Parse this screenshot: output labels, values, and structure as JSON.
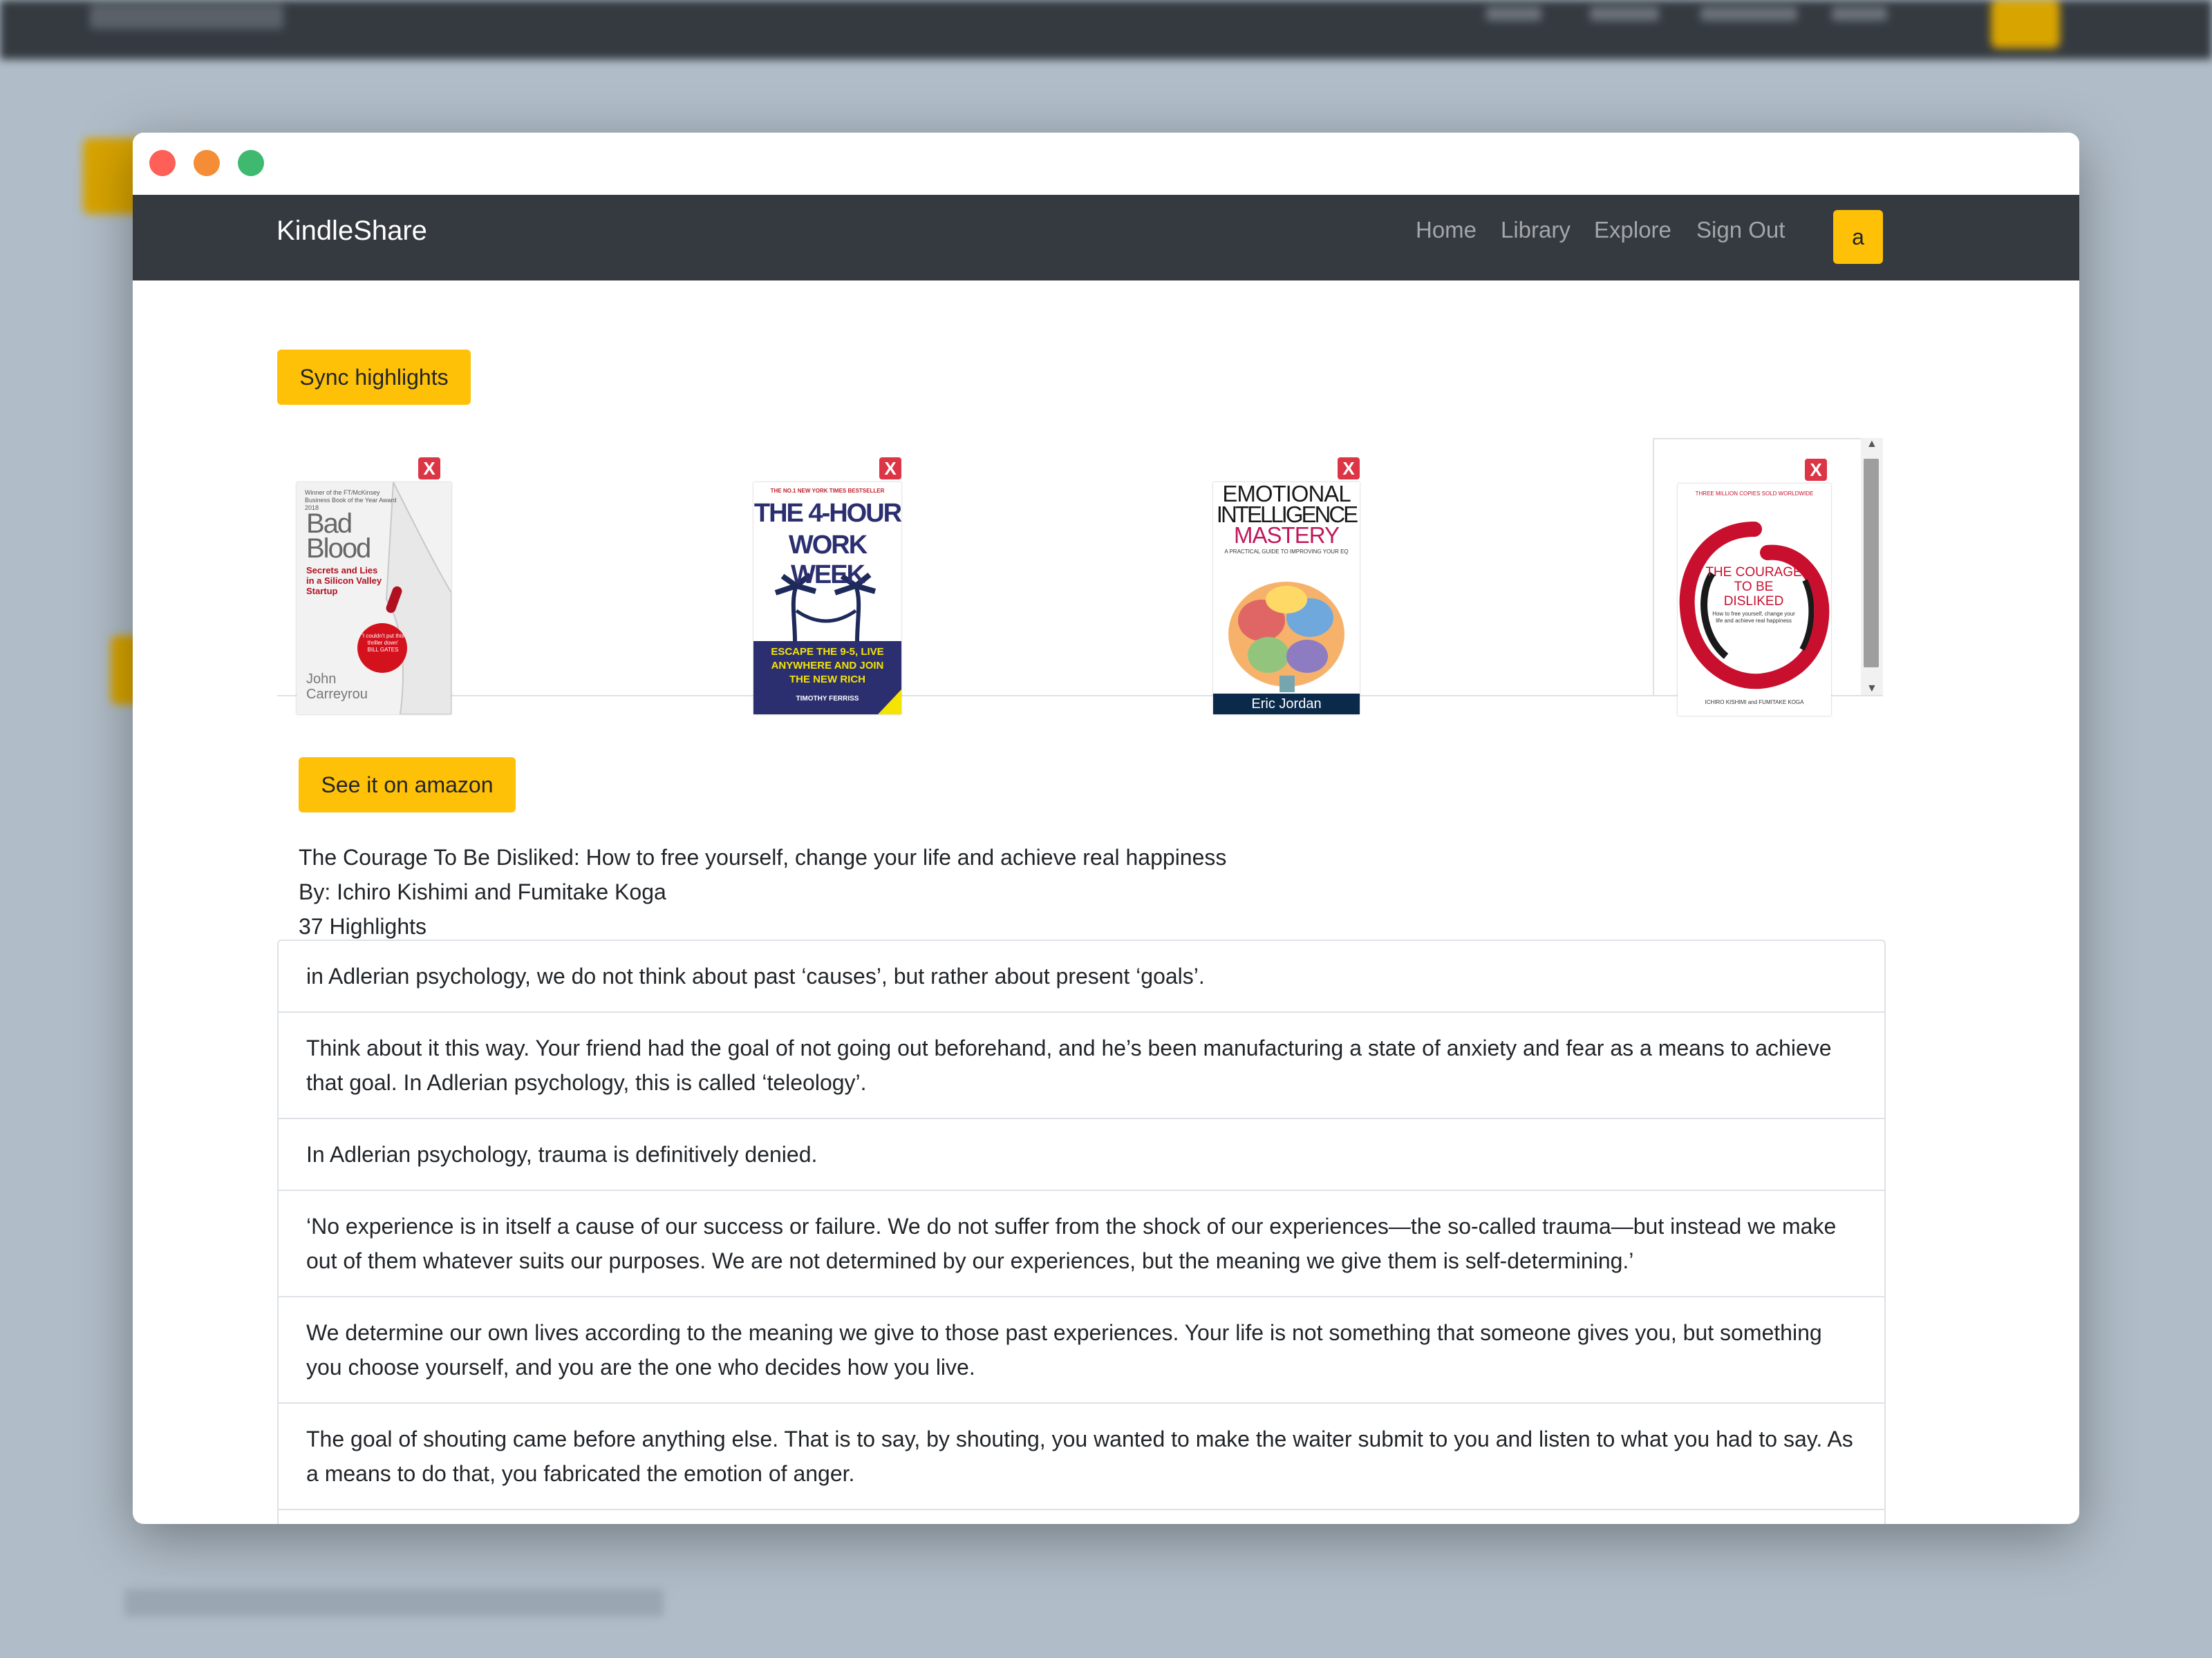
{
  "app": {
    "brand": "KindleShare",
    "nav": [
      "Home",
      "Library",
      "Explore",
      "Sign Out"
    ],
    "user_initial": "a"
  },
  "actions": {
    "sync_label": "Sync highlights",
    "amazon_label": "See it on amazon",
    "remove_label": "X"
  },
  "books": [
    {
      "cover_title": "Bad Blood",
      "cover_subtitle": "Secrets and Lies in a Silicon Valley Startup",
      "cover_author": "John Carreyrou",
      "cover_top": "Winner of the FT/McKinsey Business Book of the Year Award 2018",
      "cover_quote": "'I couldn't put this thriller down' BILL GATES"
    },
    {
      "cover_top": "THE NO.1 NEW YORK TIMES BESTSELLER",
      "cover_title_a": "THE 4-HOUR",
      "cover_title_b": "WORK WEEK",
      "cover_subtitle": "ESCAPE THE 9-5, LIVE ANYWHERE AND JOIN THE NEW RICH",
      "cover_author": "TIMOTHY FERRISS"
    },
    {
      "cover_title_a": "EMOTIONAL",
      "cover_title_b": "INTELLIGENCE",
      "cover_title_c": "MASTERY",
      "cover_subtitle": "A PRACTICAL GUIDE TO IMPROVING YOUR EQ",
      "cover_author": "Eric Jordan"
    },
    {
      "cover_top": "THREE MILLION COPIES SOLD WORLDWIDE",
      "cover_title": "THE COURAGE TO BE DISLIKED",
      "cover_subtitle": "How to free yourself, change your life and achieve real happiness",
      "cover_author": "ICHIRO KISHIMI and FUMITAKE KOGA"
    }
  ],
  "selected_book": {
    "title": "The Courage To Be Disliked: How to free yourself, change your life and achieve real happiness",
    "author": "By: Ichiro Kishimi and Fumitake Koga",
    "count": "37 Highlights"
  },
  "highlights": [
    "in Adlerian psychology, we do not think about past ‘causes’, but rather about present ‘goals’.",
    "Think about it this way. Your friend had the goal of not going out beforehand, and he’s been manufacturing a state of anxiety and fear as a means to achieve that goal. In Adlerian psychology, this is called ‘teleology’.",
    "In Adlerian psychology, trauma is definitively denied.",
    "‘No experience is in itself a cause of our success or failure. We do not suffer from the shock of our experiences—the so-called trauma—but instead we make out of them whatever suits our purposes. We are not determined by our experiences, but the meaning we give them is self-determining.’",
    "We determine our own lives according to the meaning we give to those past experiences. Your life is not something that someone gives you, but something you choose yourself, and you are the one who decides how you live.",
    "The goal of shouting came before anything else. That is to say, by shouting, you wanted to make the waiter submit to you and listen to what you had to say. As a means to do that, you fabricated the emotion of anger."
  ],
  "colors": {
    "accent": "#ffc107",
    "navbar": "#343a40",
    "danger": "#dc3545"
  }
}
